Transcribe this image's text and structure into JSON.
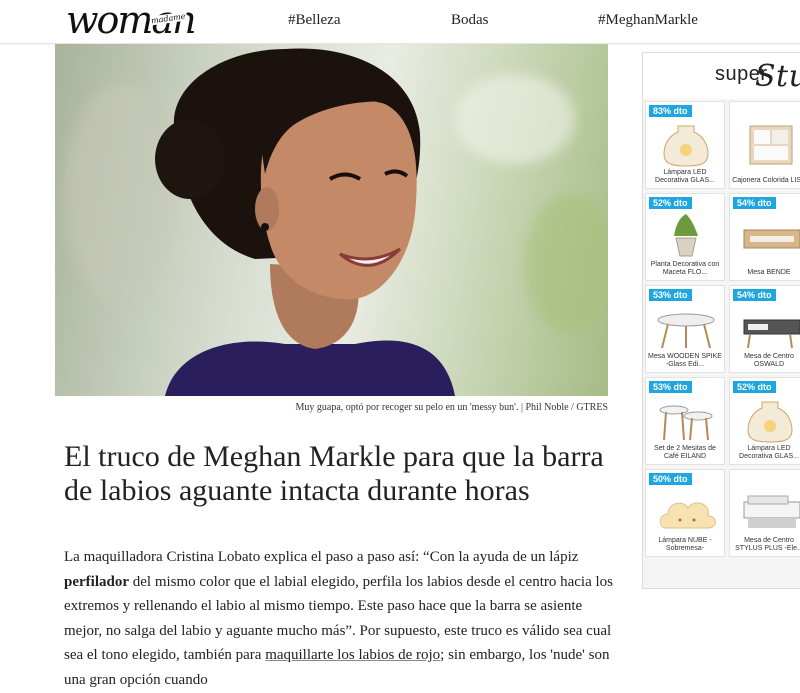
{
  "header": {
    "logo": "woman",
    "logo_sub": "madame",
    "nav": [
      "#Belleza",
      "Bodas",
      "#MeghanMarkle"
    ]
  },
  "hero": {
    "caption": "Muy guapa, optó por recoger su pelo en un 'messy bun'. | Phil Noble / GTRES"
  },
  "article": {
    "headline": "El truco de Meghan Markle para que la barra de labios aguante intacta durante horas",
    "p1_before": "La maquilladora Cristina Lobato explica el paso a paso así: “Con la ayuda de un lápiz ",
    "p1_bold": "perfilador",
    "p1_after": " del mismo color que el labial elegido, perfila los labios desde el centro hacia los extremos y rellenando el labio al mismo tiempo. Este paso hace que la barra se asiente mejor, no salga del labio y aguante mucho más”. Por supuesto, este truco es válido sea cual sea el tono elegido, también para ",
    "p1_link": "maquillarte los labios de rojo",
    "p1_end": "; sin embargo, los 'nude' son una gran opción cuando"
  },
  "ad": {
    "brand": "super",
    "brand_tail": "Stu",
    "tiles": [
      {
        "badge": "83% dto",
        "label": "Lámpara LED Decorativa GLAS..."
      },
      {
        "badge": "",
        "label": "Cajonera Colorida LISA"
      },
      {
        "badge": "52% dto",
        "label": "Planta Decorativa con Maceta FLO..."
      },
      {
        "badge": "54% dto",
        "label": "Mesa BENDE"
      },
      {
        "badge": "53% dto",
        "label": "Mesa WOODEN SPIKE -Glass Edi..."
      },
      {
        "badge": "54% dto",
        "label": "Mesa de Centro OSWALD"
      },
      {
        "badge": "53% dto",
        "label": "Set de 2 Mesitas de Café EILAND"
      },
      {
        "badge": "52% dto",
        "label": "Lámpara LED Decorativa GLAS..."
      },
      {
        "badge": "50% dto",
        "label": "Lámpara NUBE -Sobremesa-"
      },
      {
        "badge": "",
        "label": "Mesa de Centro STYLUS PLUS -Ele..."
      }
    ]
  },
  "colors": {
    "badge": "#1ea6e0",
    "text": "#222222",
    "dress": "#2a1f5c"
  }
}
